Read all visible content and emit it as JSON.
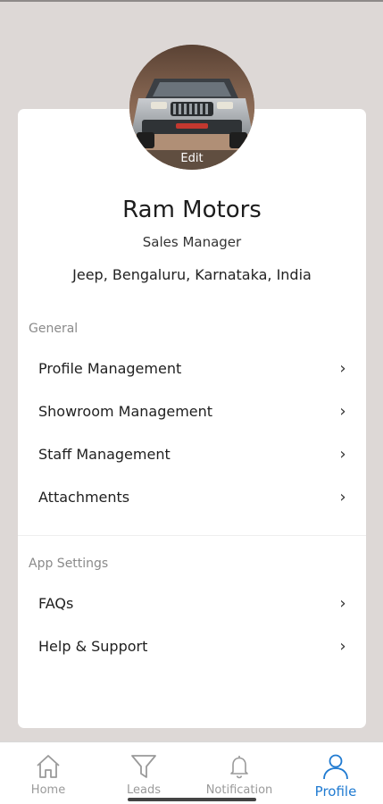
{
  "profile": {
    "edit_label": "Edit",
    "name": "Ram Motors",
    "role": "Sales Manager",
    "location": "Jeep, Bengaluru, Karnataka, India"
  },
  "general": {
    "title": "General",
    "items": [
      {
        "label": "Profile Management"
      },
      {
        "label": "Showroom Management"
      },
      {
        "label": "Staff Management"
      },
      {
        "label": "Attachments"
      }
    ]
  },
  "app_settings": {
    "title": "App Settings",
    "items": [
      {
        "label": "FAQs"
      },
      {
        "label": "Help & Support"
      }
    ]
  },
  "chevron": "›",
  "bottom_nav": {
    "items": [
      {
        "label": "Home",
        "icon": "home-icon"
      },
      {
        "label": "Leads",
        "icon": "filter-icon"
      },
      {
        "label": "Notification",
        "icon": "bell-icon"
      },
      {
        "label": "Profile",
        "icon": "person-icon",
        "active": true
      }
    ]
  },
  "colors": {
    "accent": "#1f7ad1",
    "background": "#ddd8d6",
    "card": "#ffffff",
    "muted_text": "#8a8a8a"
  }
}
